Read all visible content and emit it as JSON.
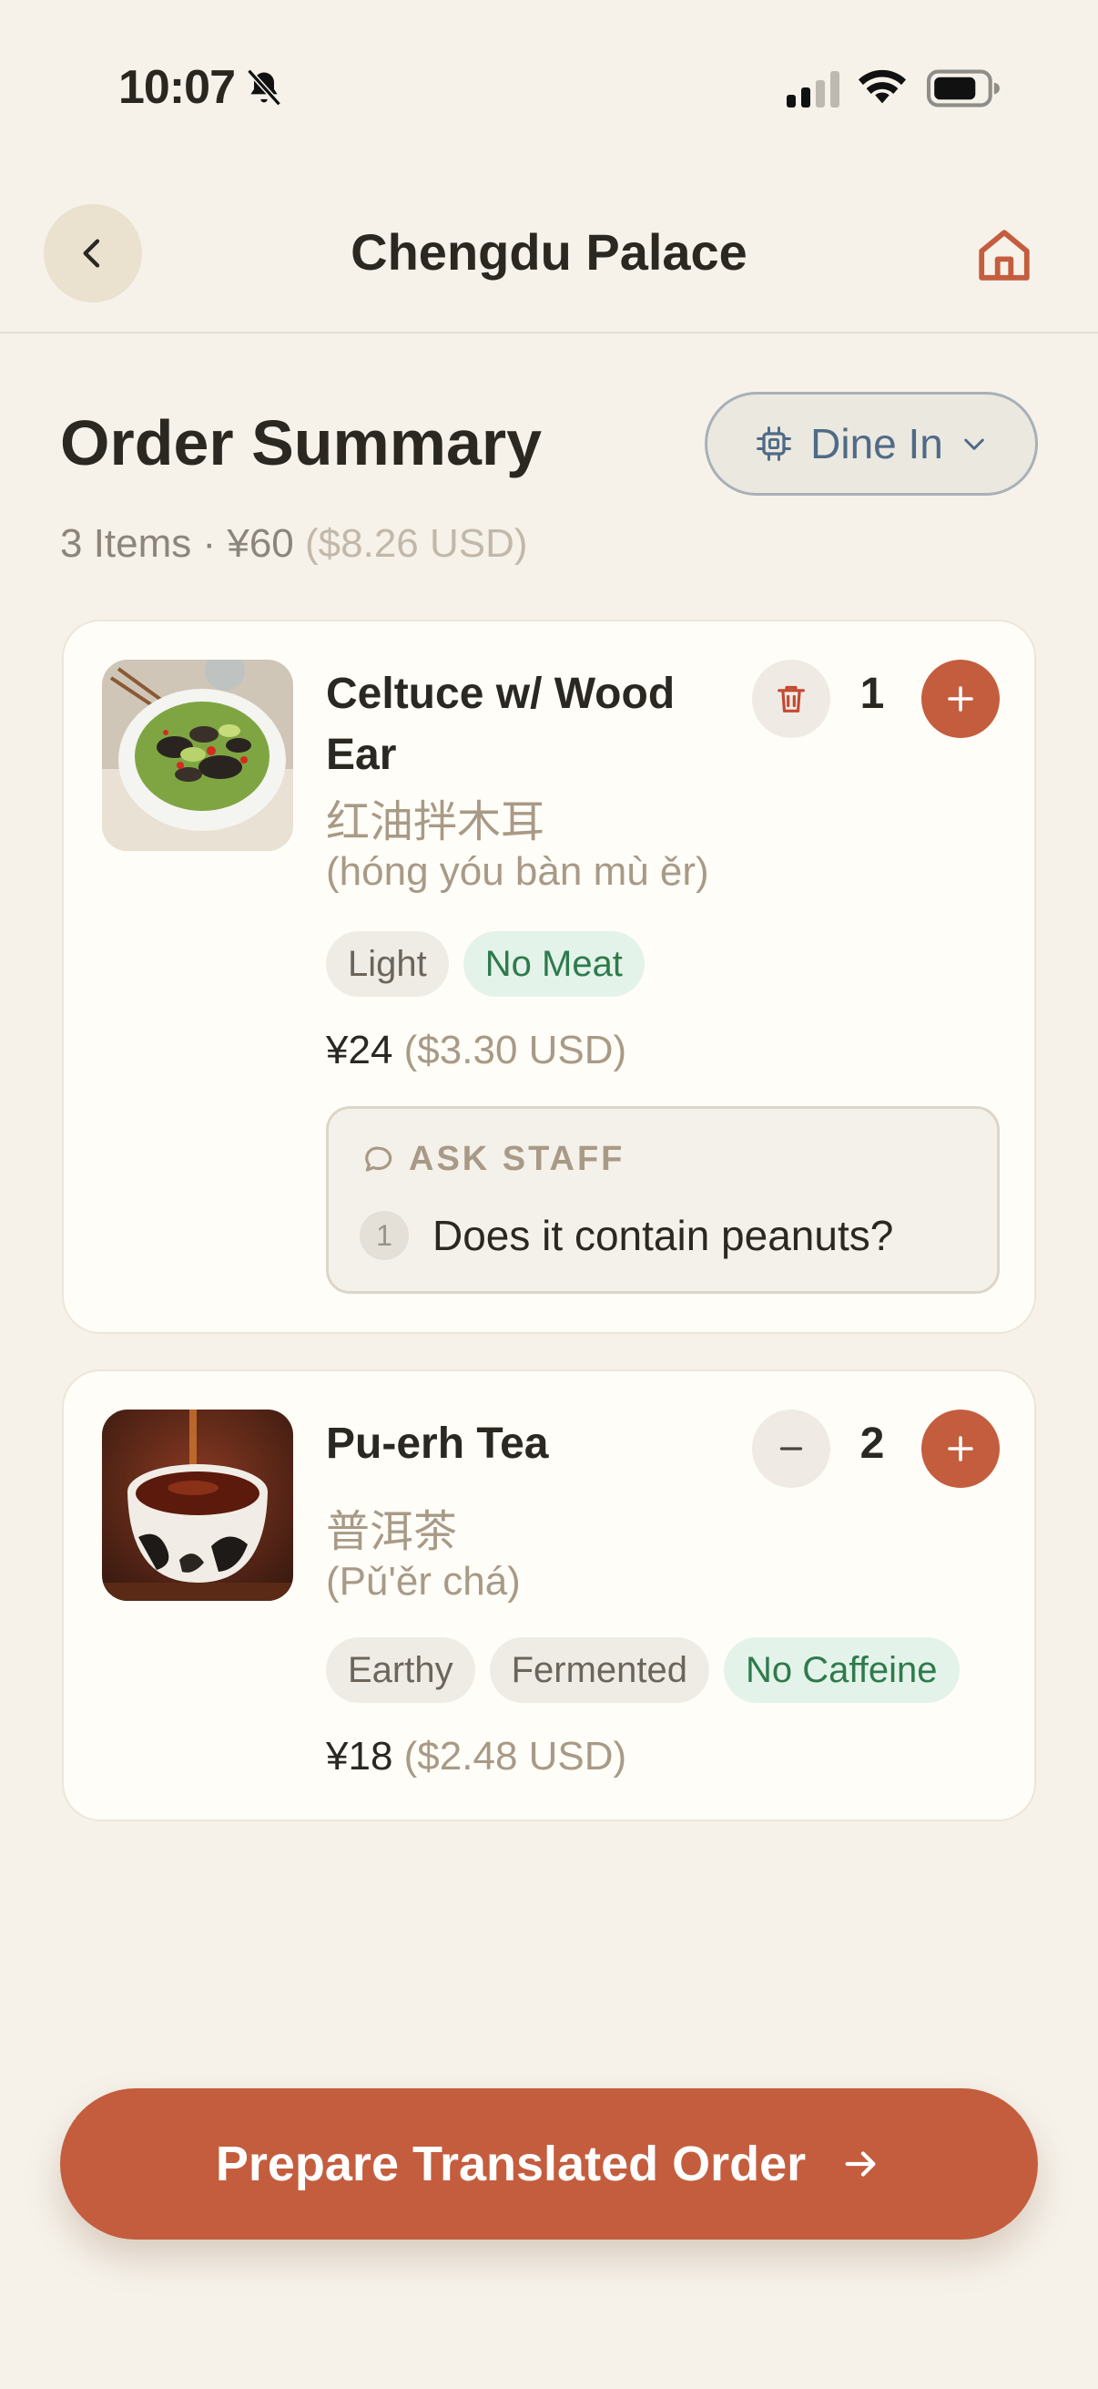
{
  "status": {
    "time": "10:07",
    "icons": [
      "bell-slash-icon",
      "signal-icon",
      "wifi-icon",
      "battery-icon"
    ]
  },
  "header": {
    "title": "Chengdu Palace",
    "back_icon": "chevron-left-icon",
    "home_icon": "home-icon"
  },
  "summary": {
    "title": "Order Summary",
    "meta": "3 Items · ¥60",
    "meta_usd": "($8.26 USD)",
    "dine_mode": "Dine In"
  },
  "items": [
    {
      "name": "Celtuce w/ Wood Ear",
      "name_zh": "红油拌木耳",
      "pinyin": "(hóng yóu bàn mù ěr)",
      "quantity": "1",
      "tags": [
        "Light",
        "No Meat"
      ],
      "price": "¥24",
      "price_usd": "($3.30 USD)",
      "ask_staff_label": "ASK STAFF",
      "questions": [
        {
          "index": "1",
          "text": "Does it contain peanuts?"
        }
      ]
    },
    {
      "name": "Pu-erh Tea",
      "name_zh": "普洱茶",
      "pinyin": "(Pǔ'ěr chá)",
      "quantity": "2",
      "tags": [
        "Earthy",
        "Fermented",
        "No Caffeine"
      ],
      "price": "¥18",
      "price_usd": "($2.48 USD)"
    }
  ],
  "cta": {
    "label": "Prepare Translated Order"
  },
  "colors": {
    "background": "#f6f2ea",
    "accent": "#c45d3e",
    "card": "#fffdf8",
    "tag_green_bg": "#e4f3e9",
    "tag_green_text": "#2f7a4d",
    "dine_text": "#4f6b85"
  }
}
